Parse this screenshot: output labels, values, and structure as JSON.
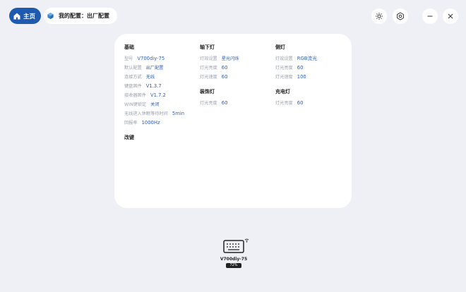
{
  "topbar": {
    "home_label": "主页",
    "breadcrumb": "我的配置：出厂配置",
    "icons": [
      "home-icon",
      "box-icon",
      "sun-icon",
      "settings-icon",
      "minimize-icon",
      "close-icon"
    ]
  },
  "basic": {
    "title": "基础",
    "rows": [
      {
        "label": "型号",
        "value": "V700diy-75"
      },
      {
        "label": "默认配置",
        "value": "出厂配置"
      },
      {
        "label": "连接方式",
        "value": "无线"
      },
      {
        "label": "键盘固件",
        "value": "V1.3.7"
      },
      {
        "label": "接收器固件",
        "value": "V1.7.2"
      },
      {
        "label": "WIN键锁定",
        "value": "关闭"
      },
      {
        "label": "无线进入休眠等待时间",
        "value": "5min"
      },
      {
        "label": "回报率",
        "value": "1000Hz"
      }
    ]
  },
  "remap": {
    "title": "改键"
  },
  "underglow": {
    "title": "轴下灯",
    "rows": [
      {
        "label": "灯效设置",
        "value": "星光闪烁"
      },
      {
        "label": "灯光亮度",
        "value": "60"
      },
      {
        "label": "灯光速度",
        "value": "60"
      }
    ]
  },
  "decor": {
    "title": "装饰灯",
    "rows": [
      {
        "label": "灯光亮度",
        "value": "60"
      }
    ]
  },
  "side": {
    "title": "侧灯",
    "rows": [
      {
        "label": "灯效设置",
        "value": "RGB流光"
      },
      {
        "label": "灯光亮度",
        "value": "60"
      },
      {
        "label": "灯光速度",
        "value": "100"
      }
    ]
  },
  "charge": {
    "title": "充电灯",
    "rows": [
      {
        "label": "灯光亮度",
        "value": "60"
      }
    ]
  },
  "device": {
    "name": "V700diy-75",
    "battery": "72%"
  },
  "colors": {
    "accent": "#1e5bb0",
    "value_text": "#2e5fb8",
    "background": "#eef0f6"
  }
}
